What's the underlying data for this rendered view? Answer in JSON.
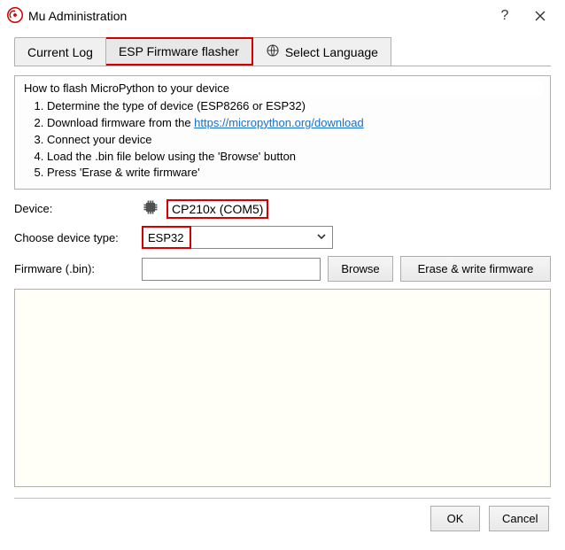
{
  "window": {
    "title": "Mu Administration"
  },
  "tabs": {
    "current_log": "Current Log",
    "firmware_flasher": "ESP Firmware flasher",
    "select_language": "Select Language"
  },
  "instructions": {
    "title": "How to flash MicroPython to your device",
    "step1": "Determine the type of device (ESP8266 or ESP32)",
    "step2_prefix": "Download firmware from the ",
    "step2_link": "https://micropython.org/download",
    "step3": "Connect your device",
    "step4": "Load the .bin file below using the 'Browse' button",
    "step5": "Press 'Erase & write firmware'"
  },
  "device": {
    "label": "Device:",
    "value": "CP210x (COM5)"
  },
  "device_type": {
    "label": "Choose device type:",
    "value": "ESP32"
  },
  "firmware": {
    "label": "Firmware (.bin):",
    "value": "",
    "browse": "Browse",
    "erase_write": "Erase & write firmware"
  },
  "buttons": {
    "ok": "OK",
    "cancel": "Cancel"
  }
}
